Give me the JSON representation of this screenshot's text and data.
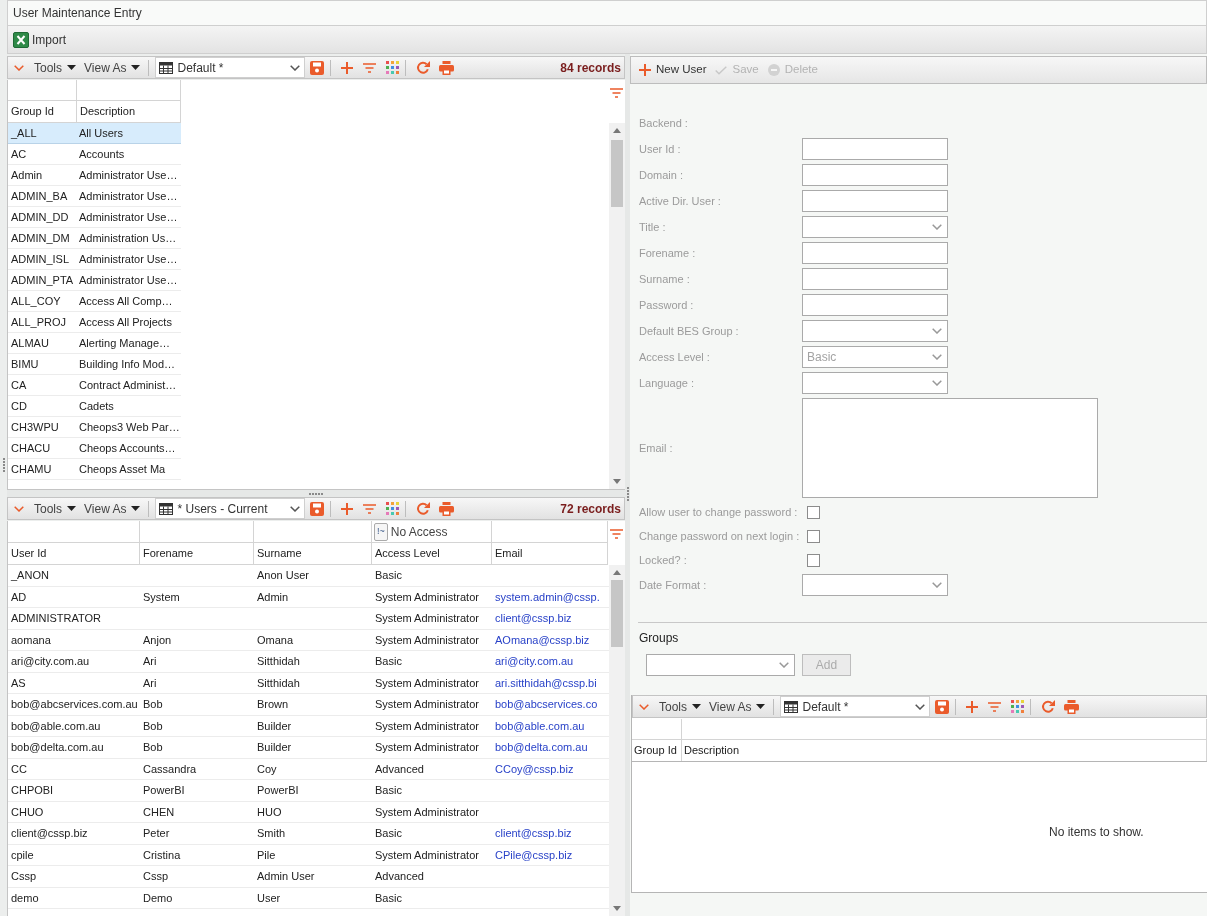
{
  "window": {
    "title": "User Maintenance Entry"
  },
  "main_toolbar": {
    "import_label": "Import"
  },
  "groups_grid": {
    "toolbar": {
      "tools": "Tools",
      "view_as": "View As",
      "view": "Default *",
      "record_count": "84 records"
    },
    "columns": [
      "Group Id",
      "Description"
    ],
    "rows": [
      {
        "group_id": "_ALL",
        "description": "All Users",
        "selected": true
      },
      {
        "group_id": "AC",
        "description": "Accounts",
        "selected": false
      },
      {
        "group_id": "Admin",
        "description": "Administrator Use…",
        "selected": false
      },
      {
        "group_id": "ADMIN_BA",
        "description": "Administrator Use…",
        "selected": false
      },
      {
        "group_id": "ADMIN_DD",
        "description": "Administrator Use…",
        "selected": false
      },
      {
        "group_id": "ADMIN_DM",
        "description": "Administration Us…",
        "selected": false
      },
      {
        "group_id": "ADMIN_ISL",
        "description": "Administrator Use…",
        "selected": false
      },
      {
        "group_id": "ADMIN_PTA",
        "description": "Administrator Use…",
        "selected": false
      },
      {
        "group_id": "ALL_COY",
        "description": "Access All Comp…",
        "selected": false
      },
      {
        "group_id": "ALL_PROJ",
        "description": "Access All Projects",
        "selected": false
      },
      {
        "group_id": "ALMAU",
        "description": "Alerting Manage…",
        "selected": false
      },
      {
        "group_id": "BIMU",
        "description": "Building Info Mod…",
        "selected": false
      },
      {
        "group_id": "CA",
        "description": "Contract Administ…",
        "selected": false
      },
      {
        "group_id": "CD",
        "description": "Cadets",
        "selected": false
      },
      {
        "group_id": "CH3WPU",
        "description": "Cheops3 Web Par…",
        "selected": false
      },
      {
        "group_id": "CHACU",
        "description": "Cheops Accounts…",
        "selected": false
      },
      {
        "group_id": "CHAMU",
        "description": "Cheops Asset Ma",
        "selected": false
      }
    ]
  },
  "users_grid": {
    "toolbar": {
      "tools": "Tools",
      "view_as": "View As",
      "view": "* Users - Current",
      "record_count": "72 records"
    },
    "columns": [
      {
        "label": "User Id",
        "kind": "text"
      },
      {
        "label": "Forename",
        "kind": "text"
      },
      {
        "label": "Surname",
        "kind": "text"
      },
      {
        "label": "Access Level",
        "kind": "text",
        "filter": {
          "operator": "!~",
          "value": "No Access"
        }
      },
      {
        "label": "Email",
        "kind": "link"
      }
    ],
    "rows": [
      {
        "user_id": "_ANON",
        "surname": "Anon User",
        "access_level": "Basic"
      },
      {
        "user_id": "AD",
        "forename": "System",
        "surname": "Admin",
        "access_level": "System Administrator",
        "email": "system.admin@cssp."
      },
      {
        "user_id": "ADMINISTRATOR",
        "access_level": "System Administrator",
        "email": "client@cssp.biz"
      },
      {
        "user_id": "aomana",
        "forename": "Anjon",
        "surname": "Omana",
        "access_level": "System Administrator",
        "email": "AOmana@cssp.biz"
      },
      {
        "user_id": "ari@city.com.au",
        "forename": "Ari",
        "surname": "Sitthidah",
        "access_level": "Basic",
        "email": "ari@city.com.au"
      },
      {
        "user_id": "AS",
        "forename": "Ari",
        "surname": "Sitthidah",
        "access_level": "System Administrator",
        "email": "ari.sitthidah@cssp.bi"
      },
      {
        "user_id": "bob@abcservices.com.au",
        "forename": "Bob",
        "surname": "Brown",
        "access_level": "System Administrator",
        "email": "bob@abcservices.co"
      },
      {
        "user_id": "bob@able.com.au",
        "forename": "Bob",
        "surname": "Builder",
        "access_level": "System Administrator",
        "email": "bob@able.com.au"
      },
      {
        "user_id": "bob@delta.com.au",
        "forename": "Bob",
        "surname": "Builder",
        "access_level": "System Administrator",
        "email": "bob@delta.com.au"
      },
      {
        "user_id": "CC",
        "forename": "Cassandra",
        "surname": "Coy",
        "access_level": "Advanced",
        "email": "CCoy@cssp.biz"
      },
      {
        "user_id": "CHPOBI",
        "forename": "PowerBI",
        "surname": "PowerBI",
        "access_level": "Basic"
      },
      {
        "user_id": "CHUO",
        "forename": "CHEN",
        "surname": "HUO",
        "access_level": "System Administrator"
      },
      {
        "user_id": "client@cssp.biz",
        "forename": "Peter",
        "surname": "Smith",
        "access_level": "Basic",
        "email": "client@cssp.biz"
      },
      {
        "user_id": "cpile",
        "forename": "Cristina",
        "surname": "Pile",
        "access_level": "System Administrator",
        "email": "CPile@cssp.biz"
      },
      {
        "user_id": "Cssp",
        "forename": "Cssp",
        "surname": "Admin User",
        "access_level": "Advanced"
      },
      {
        "user_id": "demo",
        "forename": "Demo",
        "surname": "User",
        "access_level": "Basic"
      }
    ]
  },
  "user_form": {
    "toolbar": [
      {
        "label": "New User",
        "kind": "add",
        "disabled": false
      },
      {
        "label": "Save",
        "kind": "save",
        "disabled": true
      },
      {
        "label": "Delete",
        "kind": "delete",
        "disabled": true
      }
    ],
    "fields": [
      {
        "label": "Backend :",
        "kind": "static"
      },
      {
        "label": "User Id :",
        "kind": "input"
      },
      {
        "label": "Domain :",
        "kind": "input"
      },
      {
        "label": "Active Dir. User :",
        "kind": "input"
      },
      {
        "label": "Title :",
        "kind": "select"
      },
      {
        "label": "Forename :",
        "kind": "input"
      },
      {
        "label": "Surname :",
        "kind": "input"
      },
      {
        "label": "Password :",
        "kind": "input"
      },
      {
        "label": "Default BES Group :",
        "kind": "select"
      },
      {
        "label": "Access Level :",
        "kind": "select",
        "value": "Basic"
      },
      {
        "label": "Language :",
        "kind": "select"
      },
      {
        "label": "Email :",
        "kind": "textarea"
      },
      {
        "label": "Allow user to change password :",
        "kind": "checkbox",
        "checked": false
      },
      {
        "label": "Change password on next login :",
        "kind": "checkbox",
        "checked": false
      },
      {
        "label": "Locked? :",
        "kind": "checkbox",
        "checked": false
      },
      {
        "label": "Date Format :",
        "kind": "select"
      }
    ]
  },
  "groups_section": {
    "title": "Groups",
    "add_button": {
      "label": "Add",
      "disabled": true
    },
    "grid": {
      "toolbar": {
        "tools": "Tools",
        "view_as": "View As",
        "view": "Default *"
      },
      "columns": [
        "Group Id",
        "Description"
      ],
      "empty_message": "No items to show."
    }
  }
}
